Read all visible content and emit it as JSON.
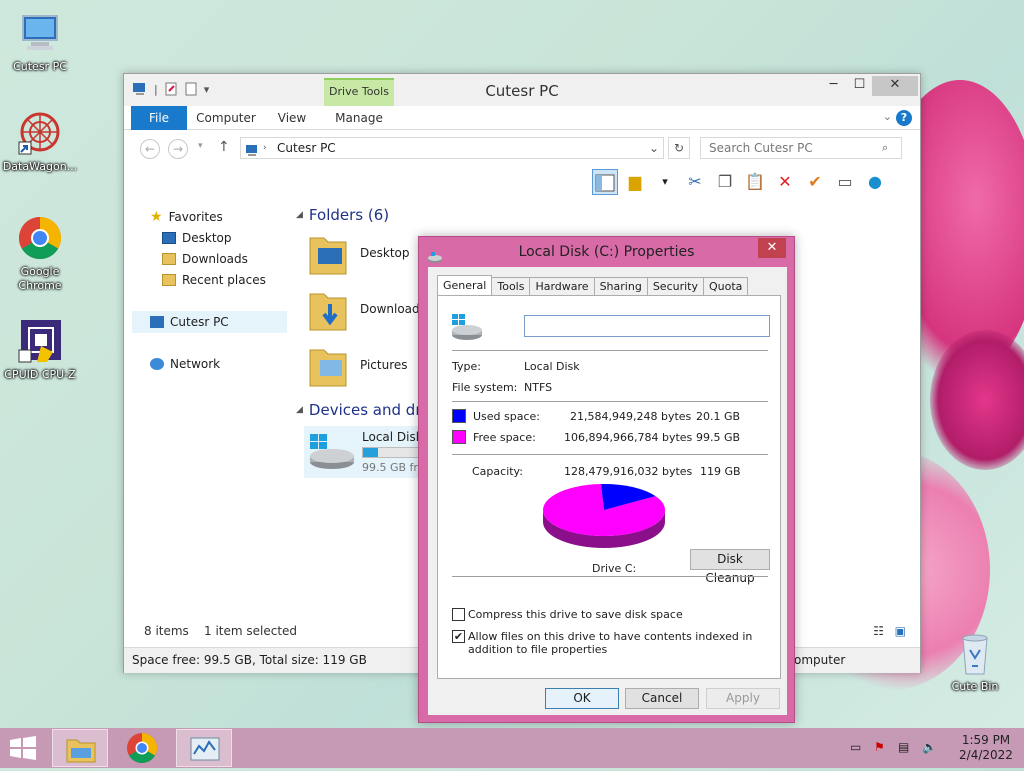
{
  "desktop": {
    "icons": [
      {
        "label": "Cutesr PC",
        "icon": "computer-icon"
      },
      {
        "label": "DataWagon...",
        "icon": "datawagon-icon"
      },
      {
        "label": "Google Chrome",
        "icon": "chrome-icon"
      },
      {
        "label": "CPUID CPU-Z",
        "icon": "cpuz-icon"
      },
      {
        "label": "Cute Bin",
        "icon": "recycle-bin-icon"
      }
    ]
  },
  "explorer": {
    "title": "Cutesr PC",
    "drive_tools_label": "Drive Tools",
    "tabs": {
      "file": "File",
      "computer": "Computer",
      "view": "View",
      "manage": "Manage"
    },
    "address": "Cutesr PC",
    "search_placeholder": "Search Cutesr PC",
    "nav": {
      "favorites": "Favorites",
      "desktop": "Desktop",
      "downloads": "Downloads",
      "recent": "Recent places",
      "this_pc": "Cutesr PC",
      "network": "Network"
    },
    "folders_header": "Folders (6)",
    "folders": [
      "Desktop",
      "Downloads",
      "Pictures"
    ],
    "devices_header": "Devices and driv",
    "drive": {
      "name": "Local Disk",
      "free_text": "99.5 GB fre",
      "used_fraction": 0.168
    },
    "status": {
      "items": "8 items",
      "selected": "1 item selected"
    },
    "footer": {
      "left": "Space free: 99.5 GB, Total size: 119 GB",
      "right": "omputer"
    }
  },
  "dialog": {
    "title": "Local Disk (C:) Properties",
    "tabs": [
      "General",
      "Tools",
      "Hardware",
      "Sharing",
      "Security",
      "Quota"
    ],
    "name_value": "",
    "type_label": "Type:",
    "type_value": "Local Disk",
    "fs_label": "File system:",
    "fs_value": "NTFS",
    "used_label": "Used space:",
    "used_bytes": "21,584,949,248 bytes",
    "used_gb": "20.1 GB",
    "free_label": "Free space:",
    "free_bytes": "106,894,966,784 bytes",
    "free_gb": "99.5 GB",
    "capacity_label": "Capacity:",
    "capacity_bytes": "128,479,916,032 bytes",
    "capacity_gb": "119 GB",
    "drive_label": "Drive C:",
    "disk_cleanup": "Disk Cleanup",
    "compress_label": "Compress this drive to save disk space",
    "compress_checked": false,
    "index_label": "Allow files on this drive to have contents indexed in addition to file properties",
    "index_checked": true,
    "ok": "OK",
    "cancel": "Cancel",
    "apply": "Apply",
    "used_color": "#0000ff",
    "free_color": "#ff00ff",
    "used_fraction": 0.168
  },
  "taskbar": {
    "time": "1:59 PM",
    "date": "2/4/2022"
  }
}
